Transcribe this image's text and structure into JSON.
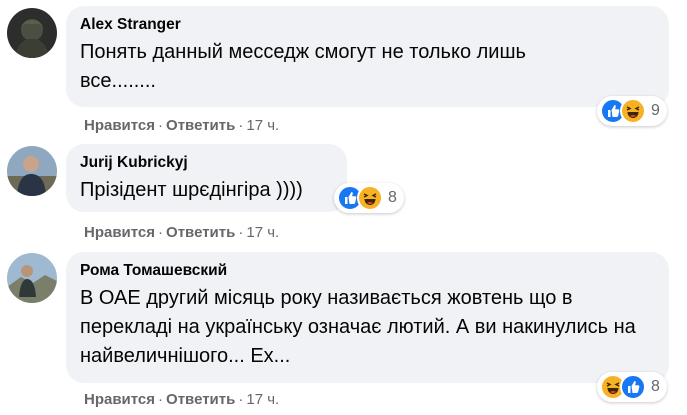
{
  "comments": [
    {
      "author": "Alex Stranger",
      "text": "Понять данный месседж смогут не только лишь все........",
      "like_label": "Нравится",
      "reply_label": "Ответить",
      "time": "17 ч.",
      "reactions": [
        "like-icon",
        "haha-icon"
      ],
      "reaction_count": "9"
    },
    {
      "author": "Jurij Kubrickyj",
      "text": "Прізідент шрєдінгіра ))))",
      "like_label": "Нравится",
      "reply_label": "Ответить",
      "time": "17 ч.",
      "reactions": [
        "like-icon",
        "haha-icon"
      ],
      "reaction_count": "8"
    },
    {
      "author": "Рома Томашевский",
      "text": "В ОАЕ другий місяць року називається жовтень що в перекладі на українську означає лютий. А ви накинулись на найвеличнішого... Ех...",
      "like_label": "Нравится",
      "reply_label": "Ответить",
      "time": "17 ч.",
      "reactions": [
        "haha-icon",
        "like-icon"
      ],
      "reaction_count": "8"
    }
  ],
  "separator": "·",
  "colors": {
    "bubble": "#f0f2f5",
    "meta_text": "#65676b",
    "like_blue": "#1877f2",
    "haha_yellow": "#f7b125"
  }
}
